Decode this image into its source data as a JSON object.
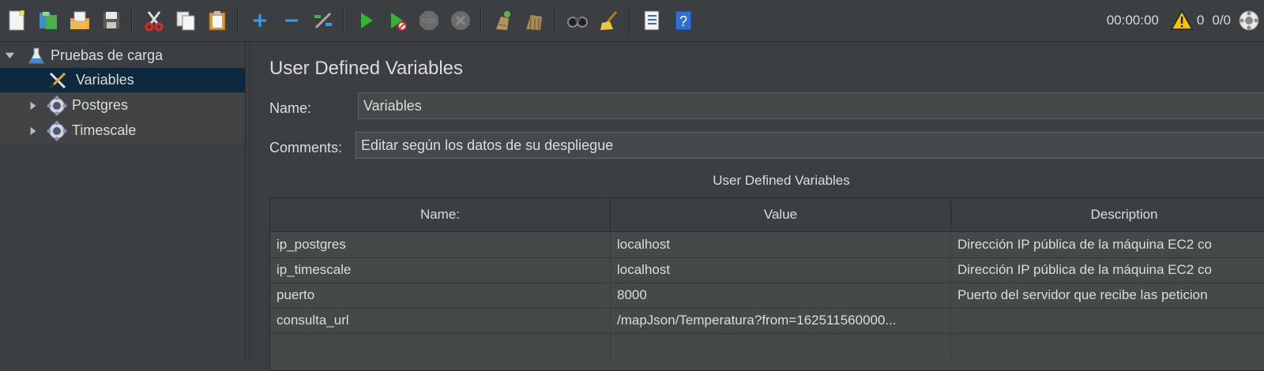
{
  "toolbar": {
    "icons": [
      "new-icon",
      "templates-icon",
      "open-icon",
      "save-icon",
      "cut-icon",
      "copy-icon",
      "paste-icon",
      "expand-icon",
      "collapse-icon",
      "toggle-icon",
      "start-icon",
      "start-no-pauses-icon",
      "stop-icon",
      "shutdown-icon",
      "clear-icon",
      "clear-all-icon",
      "search-icon",
      "reset-search-icon",
      "function-helper-icon",
      "help-icon"
    ],
    "timer": "00:00:00",
    "warning_count": "0",
    "threads": "0/0"
  },
  "tree": {
    "root": "Pruebas de carga",
    "items": [
      {
        "label": "Variables",
        "selected": true
      },
      {
        "label": "Postgres"
      },
      {
        "label": "Timescale"
      }
    ]
  },
  "panel": {
    "title": "User Defined Variables",
    "name_label": "Name:",
    "name_value": "Variables",
    "comments_label": "Comments:",
    "comments_value": "Editar según los datos de su despliegue",
    "table_caption": "User Defined Variables",
    "columns": [
      "Name:",
      "Value",
      "Description"
    ],
    "rows": [
      {
        "name": "ip_postgres",
        "value": "localhost",
        "description": "Dirección IP pública de la máquina EC2 co"
      },
      {
        "name": "ip_timescale",
        "value": "localhost",
        "description": "Dirección IP pública de la máquina EC2 co"
      },
      {
        "name": "puerto",
        "value": "8000",
        "description": "Puerto del servidor que recibe las peticion"
      },
      {
        "name": "consulta_url",
        "value": "/mapJson/Temperatura?from=162511560000...",
        "description": ""
      }
    ]
  },
  "colors": {
    "background": "#3c3f41",
    "selection": "#0d293e",
    "start_green": "#2db82d",
    "warning_yellow": "#f5c400"
  }
}
